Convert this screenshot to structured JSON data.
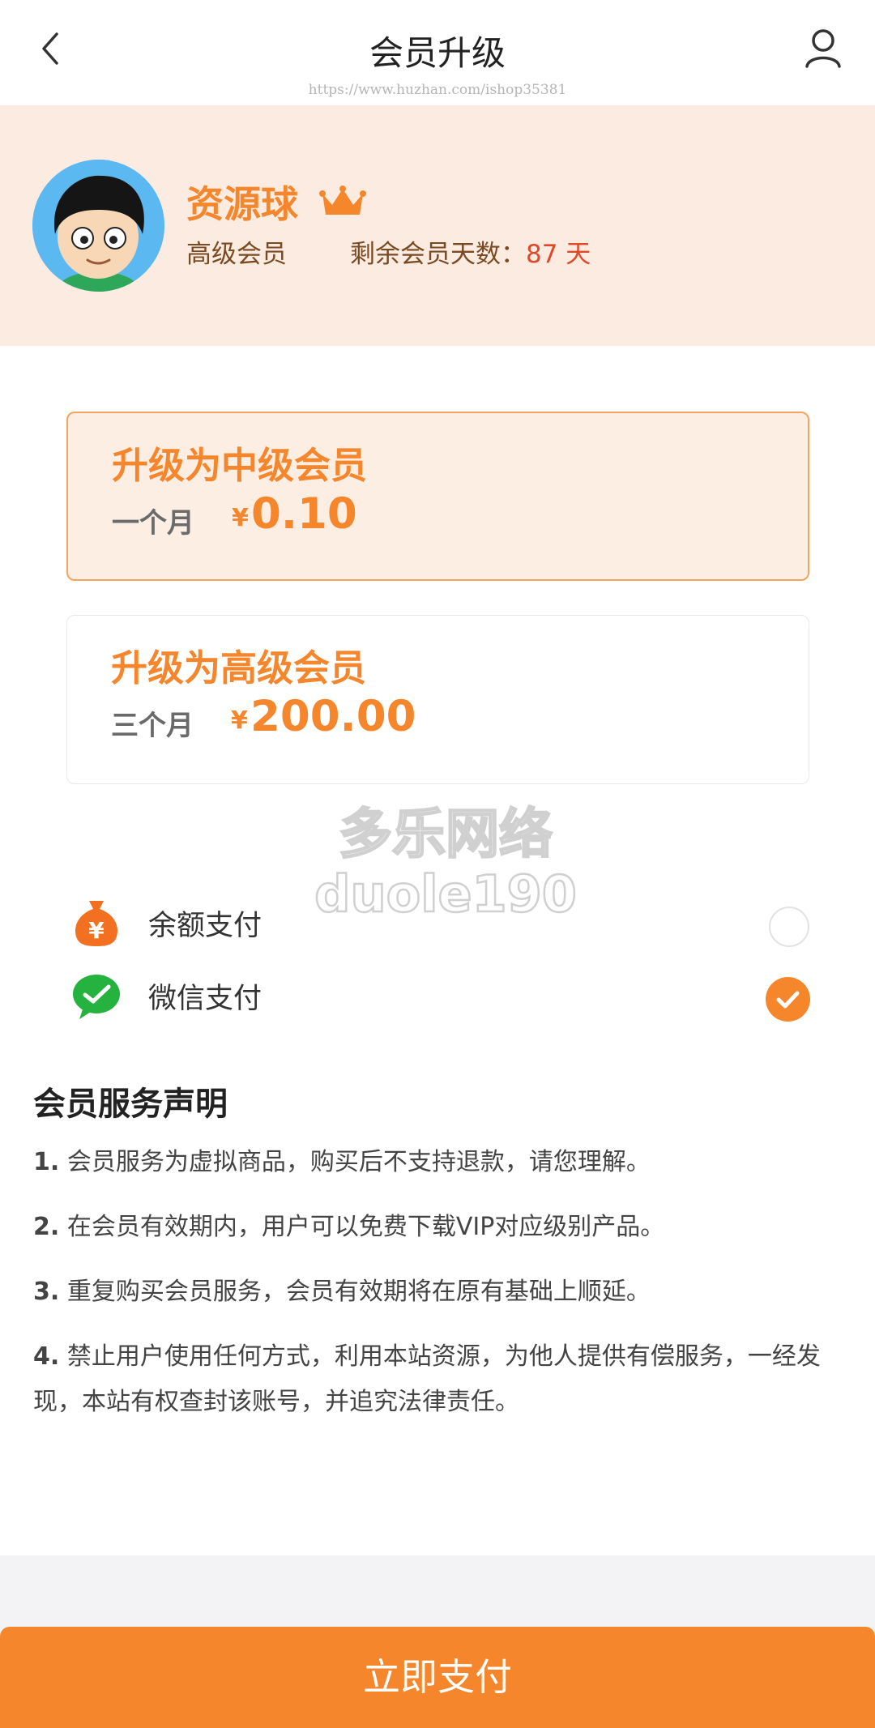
{
  "header": {
    "title": "会员升级",
    "url": "https://www.huzhan.com/ishop35381"
  },
  "profile": {
    "name": "资源球",
    "level": "高级会员",
    "remaining_label": "剩余会员天数：",
    "remaining_days": "87 天"
  },
  "plans": [
    {
      "title": "升级为中级会员",
      "period": "一个月",
      "currency": "¥",
      "price": "0.10",
      "selected": true
    },
    {
      "title": "升级为高级会员",
      "period": "三个月",
      "currency": "¥",
      "price": "200.00",
      "selected": false
    }
  ],
  "payment": {
    "methods": [
      {
        "label": "余额支付",
        "icon": "money-bag-icon",
        "checked": false
      },
      {
        "label": "微信支付",
        "icon": "wechat-icon",
        "checked": true
      }
    ]
  },
  "watermark": {
    "line1": "多乐网络",
    "line2": "duole190"
  },
  "notice": {
    "title": "会员服务声明",
    "items": [
      {
        "num": "1.",
        "text": "会员服务为虚拟商品，购买后不支持退款，请您理解。"
      },
      {
        "num": "2.",
        "text": "在会员有效期内，用户可以免费下载VIP对应级别产品。"
      },
      {
        "num": "3.",
        "text": "重复购买会员服务，会员有效期将在原有基础上顺延。"
      },
      {
        "num": "4.",
        "text": "禁止用户使用任何方式，利用本站资源，为他人提供有偿服务，一经发现，本站有权查封该账号，并追究法律责任。"
      }
    ]
  },
  "footer": {
    "pay_button": "立即支付"
  },
  "colors": {
    "accent": "#f5862c",
    "profile_bg": "#fcebe1",
    "days": "#e0482a"
  }
}
